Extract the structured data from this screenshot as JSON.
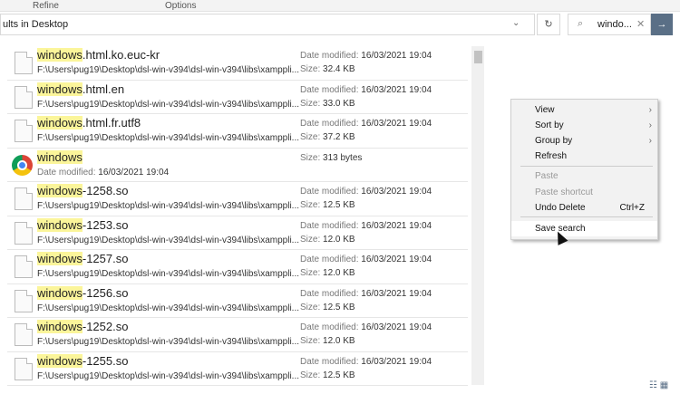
{
  "ribbon": {
    "tabs": [
      "Refine",
      "Options"
    ]
  },
  "address": {
    "text": "ults in Desktop"
  },
  "search": {
    "value": "windo..."
  },
  "highlight": "windows",
  "files": [
    {
      "rest": ".html.ko.euc-kr",
      "path": "F:\\Users\\pug19\\Desktop\\dsl-win-v394\\dsl-win-v394\\libs\\xamppli...",
      "date": "16/03/2021 19:04",
      "size": "32.4 KB"
    },
    {
      "rest": ".html.en",
      "path": "F:\\Users\\pug19\\Desktop\\dsl-win-v394\\dsl-win-v394\\libs\\xamppli...",
      "date": "16/03/2021 19:04",
      "size": "33.0 KB"
    },
    {
      "rest": ".html.fr.utf8",
      "path": "F:\\Users\\pug19\\Desktop\\dsl-win-v394\\dsl-win-v394\\libs\\xamppli...",
      "date": "16/03/2021 19:04",
      "size": "37.2 KB"
    },
    {
      "rest": "",
      "chrome": true,
      "date": "16/03/2021 19:04",
      "size": "313 bytes"
    },
    {
      "rest": "-1258.so",
      "path": "F:\\Users\\pug19\\Desktop\\dsl-win-v394\\dsl-win-v394\\libs\\xamppli...",
      "date": "16/03/2021 19:04",
      "size": "12.5 KB"
    },
    {
      "rest": "-1253.so",
      "path": "F:\\Users\\pug19\\Desktop\\dsl-win-v394\\dsl-win-v394\\libs\\xamppli...",
      "date": "16/03/2021 19:04",
      "size": "12.0 KB"
    },
    {
      "rest": "-1257.so",
      "path": "F:\\Users\\pug19\\Desktop\\dsl-win-v394\\dsl-win-v394\\libs\\xamppli...",
      "date": "16/03/2021 19:04",
      "size": "12.0 KB"
    },
    {
      "rest": "-1256.so",
      "path": "F:\\Users\\pug19\\Desktop\\dsl-win-v394\\dsl-win-v394\\libs\\xamppli...",
      "date": "16/03/2021 19:04",
      "size": "12.5 KB"
    },
    {
      "rest": "-1252.so",
      "path": "F:\\Users\\pug19\\Desktop\\dsl-win-v394\\dsl-win-v394\\libs\\xamppli...",
      "date": "16/03/2021 19:04",
      "size": "12.0 KB"
    },
    {
      "rest": "-1255.so",
      "path": "F:\\Users\\pug19\\Desktop\\dsl-win-v394\\dsl-win-v394\\libs\\xamppli...",
      "date": "16/03/2021 19:04",
      "size": "12.5 KB"
    }
  ],
  "labels": {
    "date_modified": "Date modified:",
    "size": "Size:"
  },
  "menu": {
    "items": [
      {
        "label": "View",
        "submenu": true
      },
      {
        "label": "Sort by",
        "submenu": true
      },
      {
        "label": "Group by",
        "submenu": true
      },
      {
        "label": "Refresh"
      },
      {
        "label": "Paste",
        "disabled": true
      },
      {
        "label": "Paste shortcut",
        "disabled": true
      },
      {
        "label": "Undo Delete",
        "shortcut": "Ctrl+Z"
      },
      {
        "label": "Save search",
        "highlighted": true
      }
    ]
  }
}
